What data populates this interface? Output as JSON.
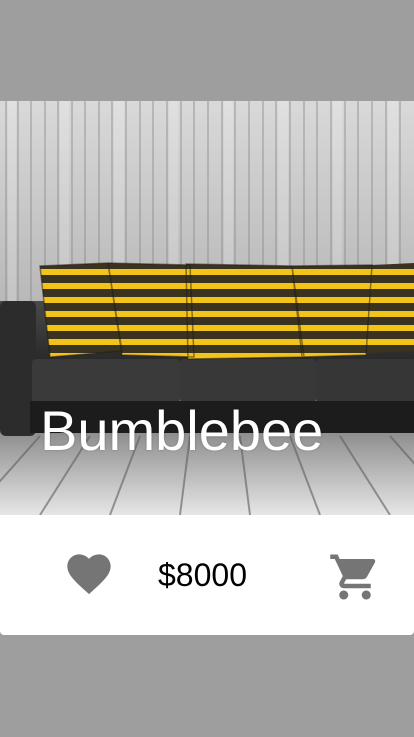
{
  "product": {
    "name": "Bumblebee",
    "price": "$8000",
    "image_description_icon": "sofa-photo"
  },
  "actions": {
    "favorite_icon": "heart-icon",
    "cart_icon": "shopping-cart-icon"
  },
  "colors": {
    "background": "#9e9e9e",
    "card": "#ffffff",
    "icon": "#757575",
    "price_text": "#000000",
    "name_text": "#ffffff",
    "pillow_yellow": "#f2c419",
    "pillow_dark": "#3a3320",
    "sofa": "#3b3b3b"
  }
}
